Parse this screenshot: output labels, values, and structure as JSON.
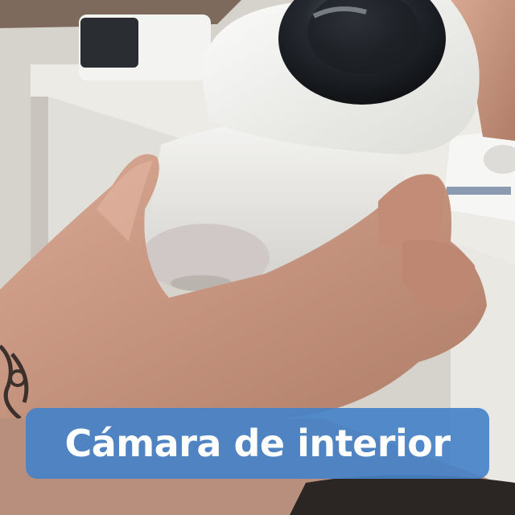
{
  "caption": {
    "text": "Cámara de interior"
  },
  "colors": {
    "caption_background": "#4682c8",
    "caption_text": "#ffffff",
    "camera_body": "#f2f2f0",
    "camera_lens": "#1e2126",
    "skin": "#c9957e",
    "wall": "#d9d5cf",
    "desk": "#ecebe6"
  }
}
